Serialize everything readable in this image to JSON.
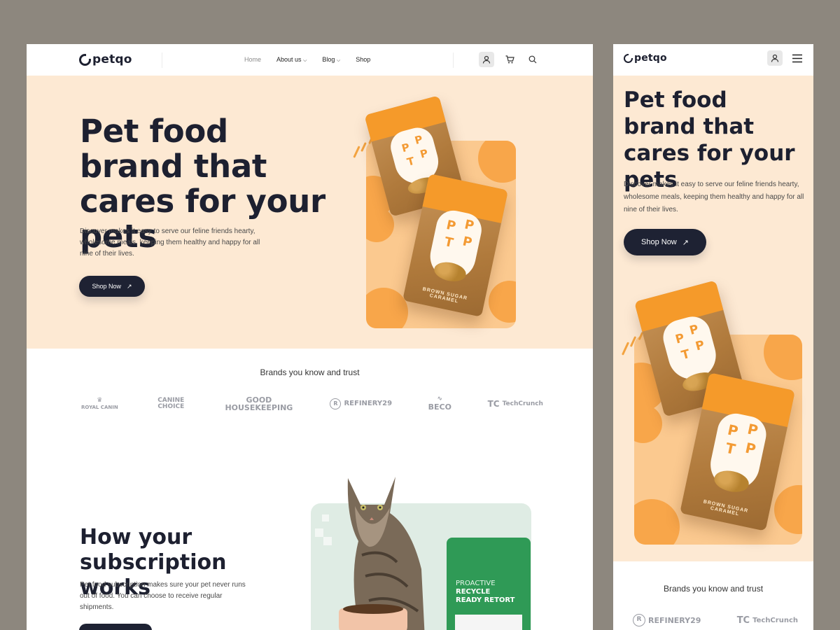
{
  "brand": {
    "name": "petqo"
  },
  "nav": {
    "links": [
      {
        "label": "Home"
      },
      {
        "label": "About us"
      },
      {
        "label": "Blog"
      },
      {
        "label": "Shop"
      }
    ],
    "icons": [
      "user-icon",
      "cart-icon",
      "search-icon"
    ]
  },
  "hero": {
    "title": "Pet food brand that cares for your pets",
    "description": "Discover makes it easy to serve our feline friends hearty, wholesome meals, keeping them healthy and happy for all nine of their lives.",
    "cta": "Shop Now",
    "product_text": "BROWN SUGAR CARAMEL",
    "product_letters": [
      "P",
      "P",
      "T",
      "P",
      "P",
      "P",
      "T",
      "P"
    ]
  },
  "brands": {
    "title": "Brands you know and trust",
    "items": [
      {
        "label": "ROYAL CANIN"
      },
      {
        "label": "CANINE CHOICE"
      },
      {
        "label": "GOOD HOUSEKEEPING"
      },
      {
        "label": "REFINERY29"
      },
      {
        "label": "BECO"
      },
      {
        "label": "TechCrunch"
      }
    ]
  },
  "subscription": {
    "title": "How your subscription works",
    "description": "Pet food subscription makes sure your pet never runs out of food. You can choose to receive regular shipments.",
    "product_lines": [
      "PROACTIVE",
      "RECYCLE",
      "READY RETORT"
    ]
  },
  "mobile": {
    "brands": [
      {
        "label": "REFINERY29"
      },
      {
        "label": "TechCrunch"
      }
    ]
  },
  "colors": {
    "background": "#8d877e",
    "hero_bg": "#fde9d3",
    "accent": "#f59a2a",
    "button": "#1e2233",
    "mint": "#dfece4",
    "green_bag": "#2f9a56"
  }
}
